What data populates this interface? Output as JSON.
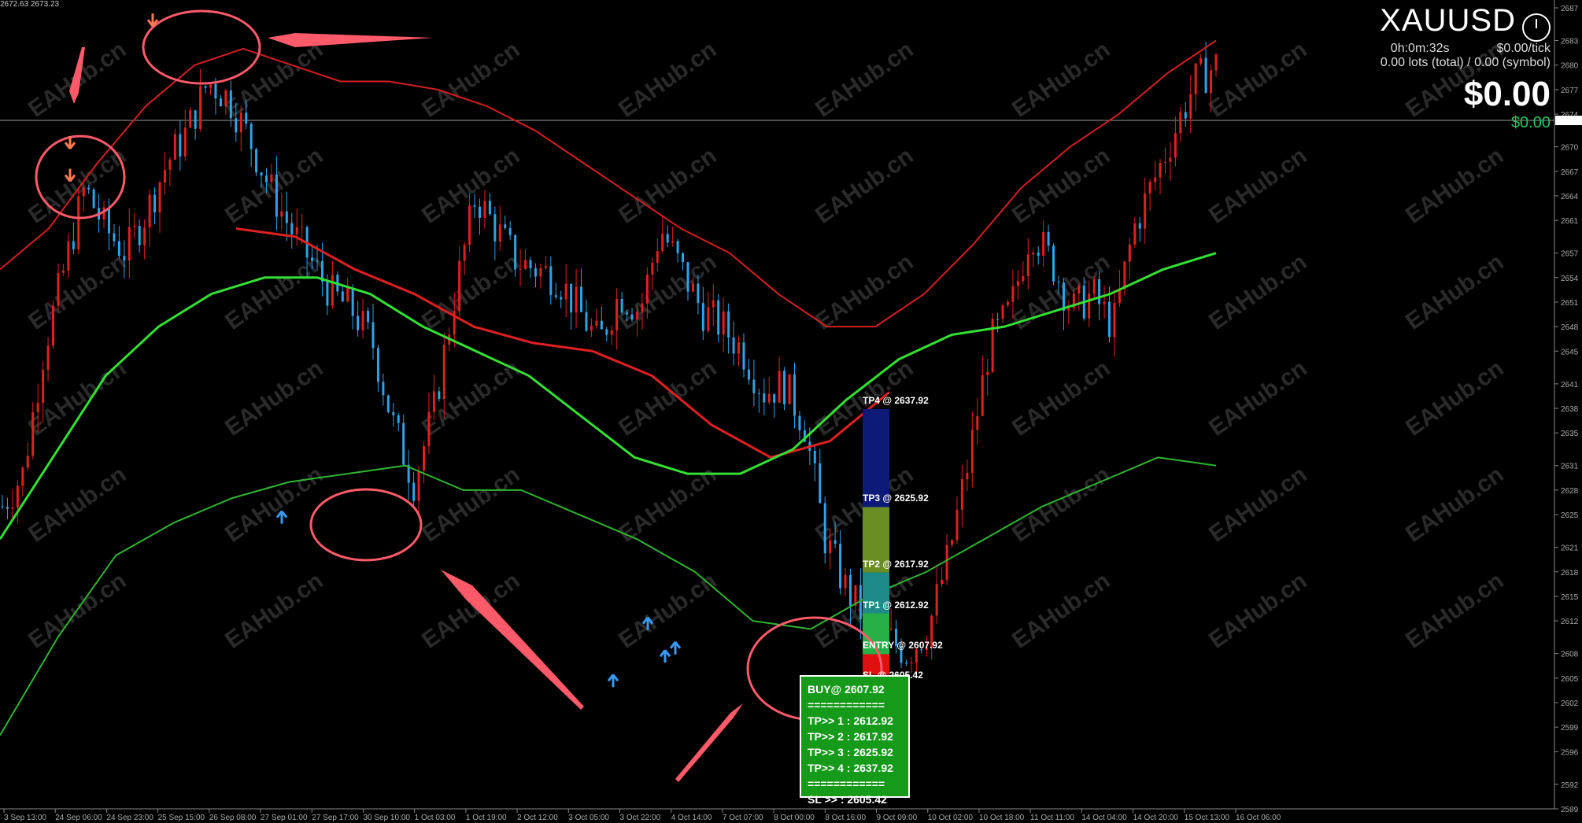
{
  "top_info": "2672.63 2673.23",
  "symbol": "XAUUSD",
  "timer": "0h:0m:32s",
  "tick_value": "$0.00/tick",
  "lots": "0.00 lots (total) / 0.00 (symbol)",
  "profit": "$0.00",
  "profit_small": "$0.00",
  "watermark": "EAHub.cn",
  "colors": {
    "bull": "#e0201f",
    "bear": "#2ea3e8",
    "upper_band": "#d41f1f",
    "mid_red": "#e02020",
    "green_mid": "#33e033",
    "lower_band": "#2fb52f",
    "tp4": "#0e1a78",
    "tp3": "#6b8e23",
    "tp2": "#1e8a8a",
    "tp1": "#28b048",
    "sl": "#e01010",
    "annot": "#ff5a6a"
  },
  "buy_box": {
    "title": "BUY@ 2607.92",
    "sep": "============",
    "tp1": "TP>> 1 : 2612.92",
    "tp2": "TP>> 2 : 2617.92",
    "tp3": "TP>> 3 : 2625.92",
    "tp4": "TP>> 4 : 2637.92",
    "sep2": "============",
    "sl": "SL >> : 2605.42"
  },
  "levels": {
    "tp4": "TP4 @ 2637.92",
    "tp3": "TP3 @ 2625.92",
    "tp2": "TP2 @ 2617.92",
    "tp1": "TP1 @ 2612.92",
    "entry": "ENTRY @ 2607.92",
    "sl": "SL @ 2605.42"
  },
  "chart_data": {
    "type": "candlestick",
    "symbol": "XAUUSD",
    "ylim": [
      2589,
      2687
    ],
    "y_ticks": [
      2687,
      2683,
      2680,
      2677,
      2674,
      2670,
      2667,
      2664,
      2661,
      2657,
      2654,
      2651,
      2648,
      2645,
      2641,
      2638,
      2635,
      2631,
      2628,
      2625,
      2621,
      2618,
      2615,
      2612,
      2608,
      2605,
      2602,
      2599,
      2596,
      2592,
      2589
    ],
    "current_price": 2673.23,
    "x_labels": [
      "3 Sep 13:00",
      "24 Sep 06:00",
      "24 Sep 23:00",
      "25 Sep 15:00",
      "26 Sep 08:00",
      "27 Sep 01:00",
      "27 Sep 17:00",
      "30 Sep 10:00",
      "1 Oct 03:00",
      "1 Oct 19:00",
      "2 Oct 12:00",
      "3 Oct 05:00",
      "3 Oct 22:00",
      "4 Oct 14:00",
      "7 Oct 07:00",
      "8 Oct 00:00",
      "8 Oct 16:00",
      "9 Oct 09:00",
      "10 Oct 02:00",
      "10 Oct 18:00",
      "11 Oct 11:00",
      "14 Oct 04:00",
      "14 Oct 20:00",
      "15 Oct 13:00",
      "16 Oct 06:00"
    ],
    "close_path": [
      2626,
      2630,
      2645,
      2655,
      2665,
      2660,
      2657,
      2662,
      2668,
      2672,
      2678,
      2676,
      2671,
      2665,
      2660,
      2656,
      2652,
      2650,
      2646,
      2636,
      2629,
      2638,
      2652,
      2664,
      2660,
      2656,
      2655,
      2654,
      2650,
      2646,
      2652,
      2650,
      2660,
      2655,
      2650,
      2648,
      2645,
      2640,
      2641,
      2636,
      2622,
      2616,
      2612,
      2610,
      2608,
      2611,
      2620,
      2632,
      2646,
      2650,
      2660,
      2656,
      2650,
      2652,
      2648,
      2660,
      2666,
      2672,
      2678,
      2680
    ],
    "indicators": {
      "upper_band": [
        2655,
        2660,
        2668,
        2675,
        2680,
        2682,
        2680,
        2678,
        2678,
        2677,
        2675,
        2672,
        2668,
        2664,
        2660,
        2657,
        2652,
        2648,
        2648,
        2652,
        2658,
        2665,
        2670,
        2674,
        2679,
        2683
      ],
      "mid_red": [
        2660,
        2659,
        2655,
        2652,
        2648,
        2646,
        2645,
        2642,
        2636,
        2632,
        2634,
        2640
      ],
      "green_upper": [
        2622,
        2632,
        2642,
        2648,
        2652,
        2654,
        2654,
        2652,
        2648,
        2645,
        2642,
        2637,
        2632,
        2630,
        2630,
        2633,
        2639,
        2644,
        2647,
        2648,
        2650,
        2652,
        2655,
        2657
      ],
      "green_lower": [
        2598,
        2610,
        2620,
        2624,
        2627,
        2629,
        2630,
        2631,
        2628,
        2628,
        2625,
        2622,
        2618,
        2612,
        2611,
        2615,
        2618,
        2622,
        2626,
        2629,
        2632,
        2631
      ]
    },
    "signals": {
      "sell": [
        [
          89,
          2665
        ],
        [
          89,
          2669
        ],
        [
          194,
          2684
        ]
      ],
      "buy": [
        [
          358,
          2626
        ],
        [
          779,
          2606
        ],
        [
          823,
          2613
        ],
        [
          845,
          2609
        ],
        [
          858,
          2610
        ]
      ]
    },
    "trade_levels": {
      "entry": 2607.92,
      "sl": 2605.42,
      "tp1": 2612.92,
      "tp2": 2617.92,
      "tp3": 2625.92,
      "tp4": 2637.92
    }
  }
}
